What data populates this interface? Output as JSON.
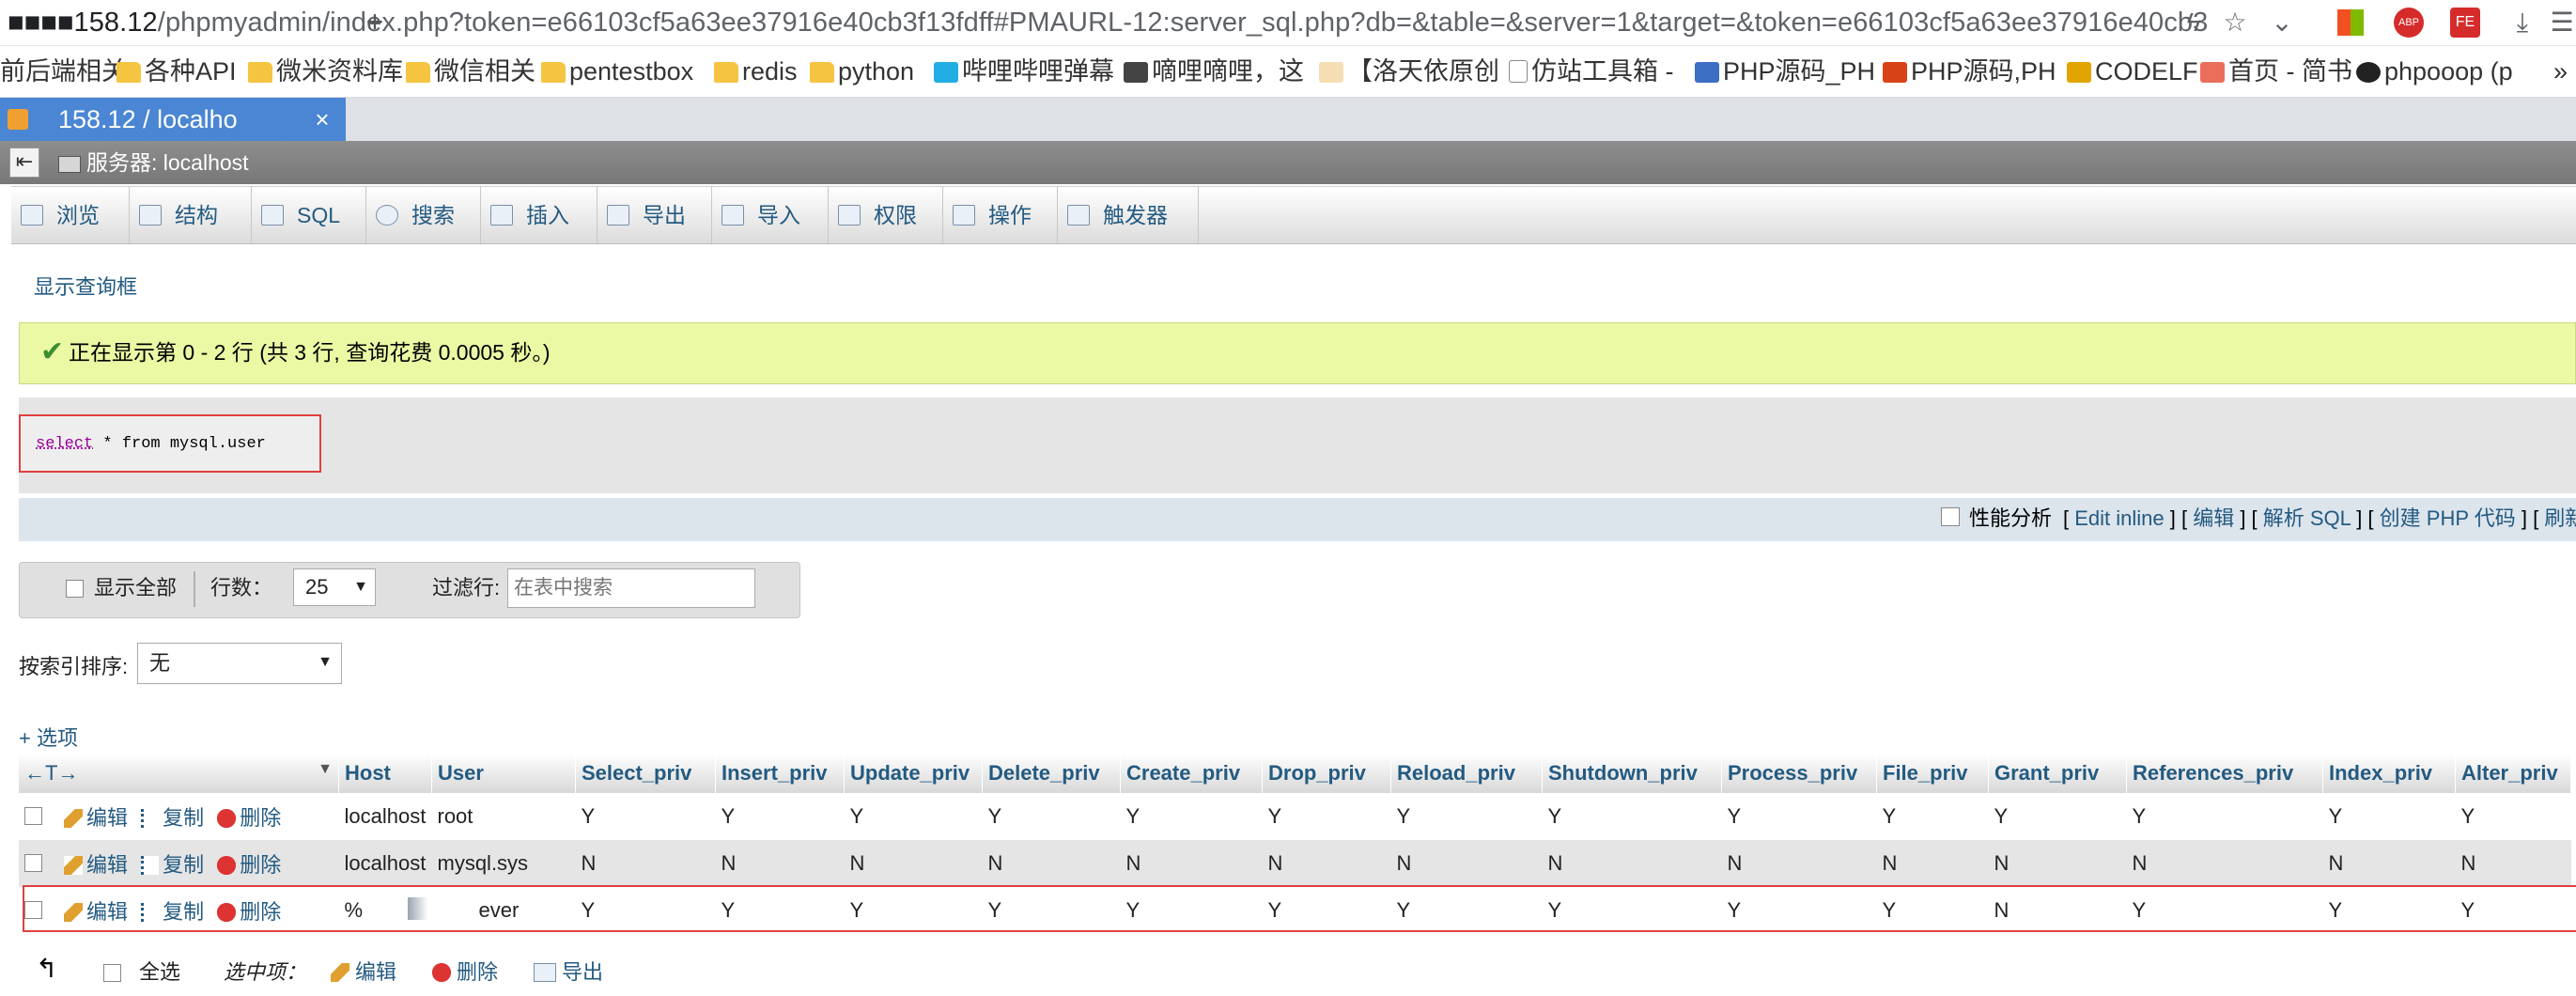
{
  "browser": {
    "url_prefix": "■■■■",
    "url_host": "158.12",
    "url_rest": "/phpmyadmin/index.php?token=e66103cf5a63ee37916e40cb3f13fdff#PMAURL-12:server_sql.php?db=&table=&server=1&target=&token=e66103cf5a63ee37916e40cb3",
    "bookmarks": [
      {
        "label": "前后端相关",
        "icon": "folder-icon"
      },
      {
        "label": "各种API",
        "icon": "folder-icon"
      },
      {
        "label": "微米资料库",
        "icon": "folder-icon"
      },
      {
        "label": "微信相关",
        "icon": "folder-icon"
      },
      {
        "label": "pentestbox",
        "icon": "folder-icon"
      },
      {
        "label": "redis",
        "icon": "folder-icon"
      },
      {
        "label": "python",
        "icon": "folder-icon"
      },
      {
        "label": "哔哩哔哩弹幕",
        "icon": "bilibili-icon"
      },
      {
        "label": "嘀哩嘀哩，这",
        "icon": "site-icon"
      },
      {
        "label": "【洛天依原创",
        "icon": "site-icon"
      },
      {
        "label": "仿站工具箱 -",
        "icon": "page-icon"
      },
      {
        "label": "PHP源码_PH",
        "icon": "php-icon"
      },
      {
        "label": "PHP源码,PH",
        "icon": "php-icon"
      },
      {
        "label": "CODELF",
        "icon": "site-icon"
      },
      {
        "label": "首页 - 简书",
        "icon": "jianshu-icon"
      },
      {
        "label": "phpooop (p",
        "icon": "github-icon"
      }
    ],
    "more_bookmarks": "»",
    "tab_title": "158.12 / localho",
    "tab_close": "×",
    "new_tab": "+"
  },
  "pma": {
    "server_label": "服务器: localhost",
    "menu": [
      {
        "label": "浏览",
        "icon": "browse-icon"
      },
      {
        "label": "结构",
        "icon": "structure-icon"
      },
      {
        "label": "SQL",
        "icon": "sql-icon"
      },
      {
        "label": "搜索",
        "icon": "search-icon"
      },
      {
        "label": "插入",
        "icon": "insert-icon"
      },
      {
        "label": "导出",
        "icon": "export-icon"
      },
      {
        "label": "导入",
        "icon": "import-icon"
      },
      {
        "label": "权限",
        "icon": "privileges-icon"
      },
      {
        "label": "操作",
        "icon": "operations-icon"
      },
      {
        "label": "触发器",
        "icon": "triggers-icon"
      }
    ],
    "show_query_box": "显示查询框",
    "success": "正在显示第 0 - 2 行 (共 3 行, 查询花费 0.0005 秒。)",
    "sql": {
      "kw": "select",
      "rest": " * from mysql.user"
    },
    "profiling_label": "性能分析",
    "query_links": [
      "Edit inline",
      "编辑",
      "解析 SQL",
      "创建 PHP 代码",
      "刷新"
    ],
    "nav": {
      "show_all": "显示全部",
      "rows_label": "行数：",
      "rows_value": "25",
      "filter_label": "过滤行:",
      "filter_placeholder": "在表中搜索"
    },
    "sort": {
      "label": "按索引排序:",
      "value": "无"
    },
    "options_link": "+ 选项",
    "table": {
      "arrows": "←T→",
      "sort_arrow": "▼",
      "columns": [
        "Host",
        "User",
        "Select_priv",
        "Insert_priv",
        "Update_priv",
        "Delete_priv",
        "Create_priv",
        "Drop_priv",
        "Reload_priv",
        "Shutdown_priv",
        "Process_priv",
        "File_priv",
        "Grant_priv",
        "References_priv",
        "Index_priv",
        "Alter_priv"
      ],
      "actions": {
        "edit": "编辑",
        "copy": "复制",
        "delete": "删除"
      },
      "rows": [
        [
          "localhost",
          "root",
          "Y",
          "Y",
          "Y",
          "Y",
          "Y",
          "Y",
          "Y",
          "Y",
          "Y",
          "Y",
          "Y",
          "Y",
          "Y",
          "Y"
        ],
        [
          "localhost",
          "mysql.sys",
          "N",
          "N",
          "N",
          "N",
          "N",
          "N",
          "N",
          "N",
          "N",
          "N",
          "N",
          "N",
          "N",
          "N"
        ],
        [
          "%",
          "ever",
          "Y",
          "Y",
          "Y",
          "Y",
          "Y",
          "Y",
          "Y",
          "Y",
          "Y",
          "Y",
          "N",
          "Y",
          "Y",
          "Y"
        ]
      ]
    },
    "bulk": {
      "check_all": "全选",
      "with_selected": "选中项：",
      "edit": "编辑",
      "delete": "删除",
      "export": "导出"
    }
  }
}
